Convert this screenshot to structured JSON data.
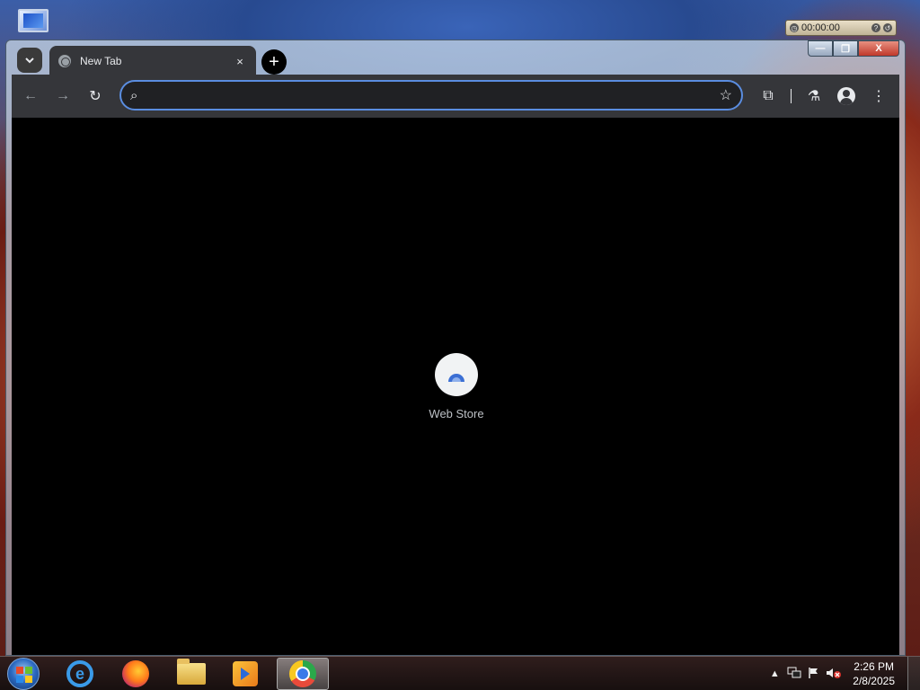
{
  "gadget": {
    "time": "00:00:00"
  },
  "window": {
    "controls": {
      "minimize": "—",
      "maximize": "❐",
      "close": "X"
    }
  },
  "tabs": [
    {
      "title": "New Tab",
      "close_glyph": "×"
    }
  ],
  "new_tab_glyph": "+",
  "toolbar": {
    "back_glyph": "←",
    "forward_glyph": "→",
    "reload_glyph": "↻",
    "search_glyph": "⌕",
    "omnibox_value": "",
    "bookmark_glyph": "☆",
    "extensions_glyph": "⧉",
    "labs_glyph": "⚗",
    "menu_glyph": "⋮"
  },
  "shortcuts": [
    {
      "label": "Web Store"
    }
  ],
  "taskbar": {
    "apps": [
      {
        "name": "internet-explorer"
      },
      {
        "name": "firefox"
      },
      {
        "name": "file-explorer"
      },
      {
        "name": "media-player"
      },
      {
        "name": "chrome",
        "active": true
      }
    ],
    "tray": {
      "show_hidden_glyph": "▲",
      "clock_time": "2:26 PM",
      "clock_date": "2/8/2025"
    }
  }
}
